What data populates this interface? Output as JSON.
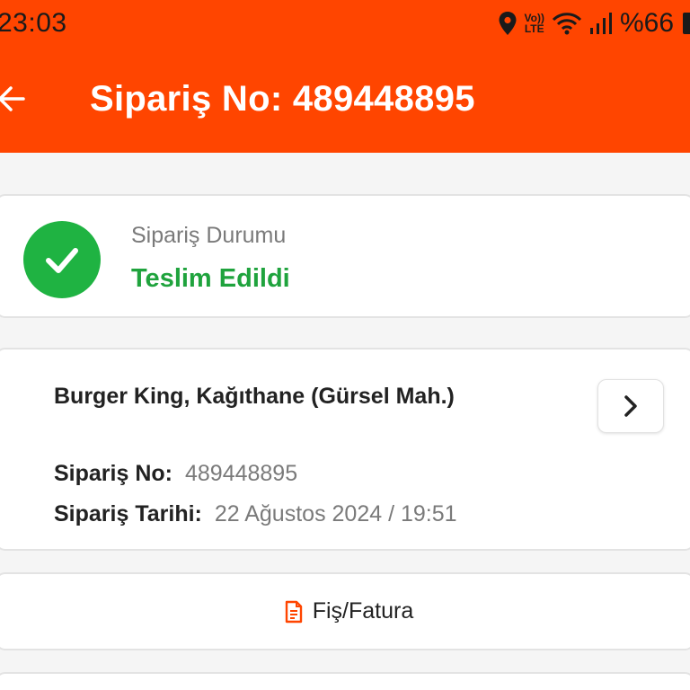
{
  "status_bar": {
    "time": "23:03",
    "volte_top": "Vo))",
    "volte_bottom": "LTE",
    "battery": "%66"
  },
  "header": {
    "title": "Sipariş No: 489448895"
  },
  "order_status": {
    "label": "Sipariş Durumu",
    "value": "Teslim Edildi"
  },
  "order_info": {
    "restaurant": "Burger King, Kağıthane (Gürsel Mah.)",
    "order_no_label": "Sipariş No:",
    "order_no_value": "489448895",
    "date_label": "Sipariş Tarihi:",
    "date_value": "22 Ağustos 2024 / 19:51"
  },
  "receipt": {
    "label": "Fiş/Fatura"
  },
  "colors": {
    "header": "#ff4500",
    "success": "#1fb342",
    "success_text": "#1fa33d"
  },
  "icons": [
    "location-icon",
    "wifi-icon",
    "signal-icon",
    "battery-icon",
    "back-arrow-icon",
    "check-circle-icon",
    "chevron-right-icon",
    "receipt-icon"
  ]
}
